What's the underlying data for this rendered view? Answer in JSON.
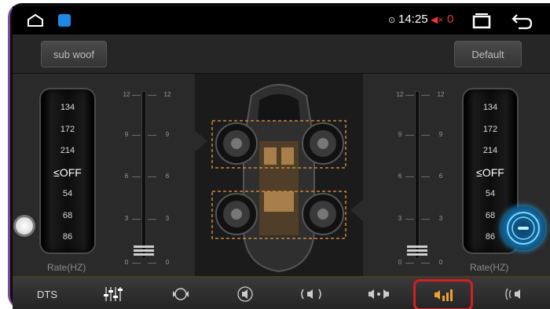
{
  "status_bar": {
    "time": "14:25",
    "notification_count": "0",
    "icons": [
      "home-icon",
      "app-icon",
      "location-icon",
      "volume-mute-icon",
      "recent-apps-icon",
      "back-icon"
    ]
  },
  "toolbar": {
    "sub_woof_label": "sub woof",
    "default_label": "Default"
  },
  "left_panel": {
    "rate_options": [
      "134",
      "172",
      "214",
      "≤OFF",
      "54",
      "68",
      "86"
    ],
    "rate_label": "Rate(HZ)",
    "slider_ticks": [
      "12",
      "9",
      "6",
      "3",
      "0"
    ]
  },
  "right_panel": {
    "rate_options": [
      "134",
      "172",
      "214",
      "≤OFF",
      "54",
      "68",
      "86"
    ],
    "rate_label": "Rate(HZ)",
    "slider_ticks": [
      "12",
      "9",
      "6",
      "3",
      "0"
    ]
  },
  "bottom_nav": {
    "dts_label": "DTS",
    "items": [
      "equalizer-icon",
      "surround-icon",
      "speaker-icon",
      "soundfield-icon",
      "balance-icon",
      "crossover-icon",
      "loudness-icon"
    ],
    "active_index": 5
  },
  "colors": {
    "accent": "#d32020",
    "assistant": "#1a7fc1",
    "highlight_box": "#c88a3a"
  }
}
